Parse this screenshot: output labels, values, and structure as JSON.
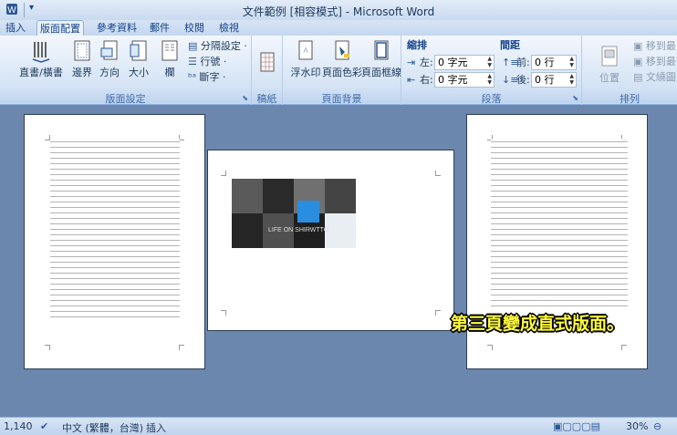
{
  "window": {
    "title": "文件範例 [相容模式] - Microsoft Word"
  },
  "tabs": [
    "插入",
    "版面配置",
    "參考資料",
    "郵件",
    "校閱",
    "檢視"
  ],
  "ribbon": {
    "page_setup": {
      "label": "版面設定",
      "buttons": [
        "直書/橫書",
        "邊界",
        "方向",
        "大小",
        "欄"
      ],
      "small": [
        "分隔設定 ·",
        "行號 ·",
        "斷字 ·"
      ]
    },
    "manuscript": {
      "label": "稿紙",
      "button": "稿紙\n設定"
    },
    "page_background": {
      "label": "頁面背景",
      "buttons": [
        "浮水印",
        "頁面色彩",
        "頁面框線"
      ]
    },
    "paragraph": {
      "label": "段落",
      "indent_header": "縮排",
      "spacing_header": "間距",
      "left_label": "左:",
      "right_label": "右:",
      "before_label": "前:",
      "after_label": "後:",
      "left_value": "0 字元",
      "right_value": "0 字元",
      "before_value": "0 行",
      "after_value": "0 行"
    },
    "arrange": {
      "label": "排列",
      "position": "位置",
      "items": [
        "移到最",
        "移到最下",
        "文繞圖"
      ]
    }
  },
  "document": {
    "page2_photo_text": "LIFE ON SHIRWTTO"
  },
  "callout": "第三頁變成直式版面。",
  "status": {
    "page_count": "1,140",
    "language": "中文 (繁體，台灣)",
    "mode": "插入",
    "zoom": "30%"
  }
}
